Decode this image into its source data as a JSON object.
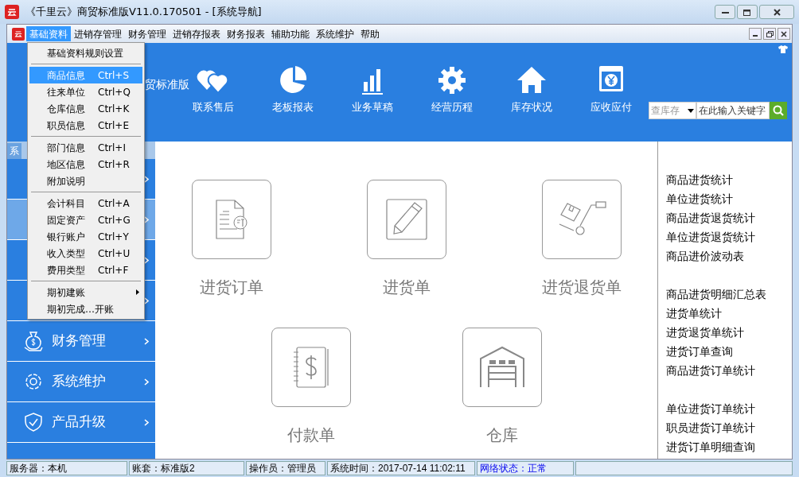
{
  "window": {
    "title": "《千里云》商贸标准版V11.0.170501 - [系统导航]"
  },
  "menubar": [
    {
      "label": "基础资料",
      "selected": true
    },
    {
      "label": "进销存管理",
      "selected": false
    },
    {
      "label": "财务管理",
      "selected": false
    },
    {
      "label": "进销存报表",
      "selected": false
    },
    {
      "label": "财务报表",
      "selected": false
    },
    {
      "label": "辅助功能",
      "selected": false
    },
    {
      "label": "系统维护",
      "selected": false
    },
    {
      "label": "帮助",
      "selected": false
    }
  ],
  "dropdown": [
    {
      "kind": "item",
      "label": "基础资料规则设置",
      "selected": false
    },
    {
      "kind": "separator"
    },
    {
      "kind": "item",
      "label": "商品信息",
      "shortcut": "Ctrl+S",
      "selected": true
    },
    {
      "kind": "item",
      "label": "往来单位",
      "shortcut": "Ctrl+Q",
      "selected": false
    },
    {
      "kind": "item",
      "label": "仓库信息",
      "shortcut": "Ctrl+K",
      "selected": false
    },
    {
      "kind": "item",
      "label": "职员信息",
      "shortcut": "Ctrl+E",
      "selected": false
    },
    {
      "kind": "separator"
    },
    {
      "kind": "item",
      "label": "部门信息",
      "shortcut": "Ctrl+I",
      "selected": false
    },
    {
      "kind": "item",
      "label": "地区信息",
      "shortcut": "Ctrl+R",
      "selected": false
    },
    {
      "kind": "item",
      "label": "附加说明",
      "selected": false
    },
    {
      "kind": "separator"
    },
    {
      "kind": "item",
      "label": "会计科目",
      "shortcut": "Ctrl+A",
      "selected": false
    },
    {
      "kind": "item",
      "label": "固定资产",
      "shortcut": "Ctrl+G",
      "selected": false
    },
    {
      "kind": "item",
      "label": "银行账户",
      "shortcut": "Ctrl+Y",
      "selected": false
    },
    {
      "kind": "item",
      "label": "收入类型",
      "shortcut": "Ctrl+U",
      "selected": false
    },
    {
      "kind": "item",
      "label": "费用类型",
      "shortcut": "Ctrl+F",
      "selected": false
    },
    {
      "kind": "separator"
    },
    {
      "kind": "submenu",
      "label": "期初建账",
      "selected": false
    },
    {
      "kind": "item",
      "label": "期初完成…开账",
      "selected": false
    }
  ],
  "header": {
    "product": "贸标准版",
    "nav": [
      {
        "kind": "heart",
        "label": "联系售后"
      },
      {
        "kind": "pie",
        "label": "老板报表"
      },
      {
        "kind": "bars",
        "label": "业务草稿"
      },
      {
        "kind": "gear",
        "label": "经营历程"
      },
      {
        "kind": "house",
        "label": "库存状况"
      },
      {
        "kind": "yen",
        "label": "应收应付"
      }
    ],
    "search": {
      "scope": "查库存",
      "placeholder": "在此输入关键字"
    }
  },
  "sidebar": {
    "tab": "系",
    "items": [
      {
        "selected": false
      },
      {
        "selected": true
      },
      {
        "selected": false
      },
      {
        "selected": false
      },
      {
        "kind": "money",
        "label": "财务管理",
        "selected": false
      },
      {
        "kind": "cog",
        "label": "系统维护",
        "selected": false
      },
      {
        "kind": "shield",
        "label": "产品升级",
        "selected": false
      }
    ]
  },
  "tiles": [
    {
      "kind": "order",
      "label": "进货订单"
    },
    {
      "kind": "pencil",
      "label": "进货单"
    },
    {
      "kind": "cart",
      "label": "进货退货单"
    },
    {
      "kind": "ledger",
      "label": "付款单"
    },
    {
      "kind": "warehouse",
      "label": "仓库"
    }
  ],
  "reports": [
    [
      "商品进货统计",
      "单位进货统计",
      "商品进货退货统计",
      "单位进货退货统计",
      "商品进价波动表"
    ],
    [
      "商品进货明细汇总表",
      "进货单统计",
      "进货退货单统计",
      "进货订单查询",
      "商品进货订单统计"
    ],
    [
      "单位进货订单统计",
      "职员进货订单统计",
      "进货订单明细查询"
    ]
  ],
  "status_bar": [
    {
      "label": "服务器：",
      "value": "本机"
    },
    {
      "label": "账套：",
      "value": "标准版2"
    },
    {
      "label": "操作员：",
      "value": "管理员"
    },
    {
      "label": "系统时间：",
      "value": "2017-07-14 11:02:11"
    },
    {
      "label": "网络状态：",
      "value": "正常",
      "kind": "network"
    }
  ]
}
